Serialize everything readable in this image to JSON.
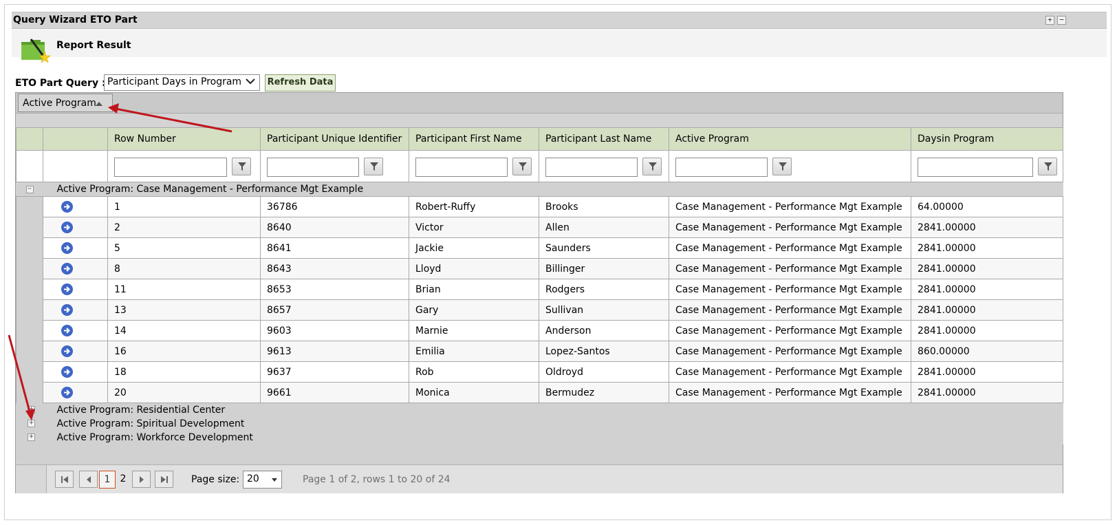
{
  "window": {
    "title": "Query Wizard ETO Part",
    "btn_maximize": "+",
    "btn_minimize": "−"
  },
  "report": {
    "label": "Report Result",
    "icon": "folder-wand-icon"
  },
  "query": {
    "label": "ETO Part Query :",
    "selected": "Participant Days in Program",
    "refresh_label": "Refresh Data"
  },
  "grouping": {
    "chip_label": "Active Program",
    "sort_direction": "ascending"
  },
  "columns": [
    "Row Number",
    "Participant Unique Identifier",
    "Participant First Name",
    "Participant Last Name",
    "Active Program",
    "Daysin Program"
  ],
  "groups": {
    "expanded": {
      "label": "Active Program: Case Management - Performance Mgt Example",
      "toggle": "−",
      "rows": [
        {
          "row": "1",
          "id": "36786",
          "first": "Robert-Ruffy",
          "last": "Brooks",
          "program": "Case Management - Performance Mgt Example",
          "days": "64.00000"
        },
        {
          "row": "2",
          "id": "8640",
          "first": "Victor",
          "last": "Allen",
          "program": "Case Management - Performance Mgt Example",
          "days": "2841.00000"
        },
        {
          "row": "5",
          "id": "8641",
          "first": "Jackie",
          "last": "Saunders",
          "program": "Case Management - Performance Mgt Example",
          "days": "2841.00000"
        },
        {
          "row": "8",
          "id": "8643",
          "first": "Lloyd",
          "last": "Billinger",
          "program": "Case Management - Performance Mgt Example",
          "days": "2841.00000"
        },
        {
          "row": "11",
          "id": "8653",
          "first": "Brian",
          "last": "Rodgers",
          "program": "Case Management - Performance Mgt Example",
          "days": "2841.00000"
        },
        {
          "row": "13",
          "id": "8657",
          "first": "Gary",
          "last": "Sullivan",
          "program": "Case Management - Performance Mgt Example",
          "days": "2841.00000"
        },
        {
          "row": "14",
          "id": "9603",
          "first": "Marnie",
          "last": "Anderson",
          "program": "Case Management - Performance Mgt Example",
          "days": "2841.00000"
        },
        {
          "row": "16",
          "id": "9613",
          "first": "Emilia",
          "last": "Lopez-Santos",
          "program": "Case Management - Performance Mgt Example",
          "days": "860.00000"
        },
        {
          "row": "18",
          "id": "9637",
          "first": "Rob",
          "last": "Oldroyd",
          "program": "Case Management - Performance Mgt Example",
          "days": "2841.00000"
        },
        {
          "row": "20",
          "id": "9661",
          "first": "Monica",
          "last": "Bermudez",
          "program": "Case Management - Performance Mgt Example",
          "days": "2841.00000"
        }
      ]
    },
    "collapsed": [
      {
        "label": "Active Program: Residential Center",
        "toggle": "+"
      },
      {
        "label": "Active Program: Spiritual Development",
        "toggle": "+"
      },
      {
        "label": "Active Program: Workforce Development",
        "toggle": "+"
      }
    ]
  },
  "pager": {
    "pages": [
      "1",
      "2"
    ],
    "current_page": "1",
    "page_size_label": "Page size:",
    "page_size": "20",
    "info": "Page 1 of 2, rows 1 to 20 of 24"
  },
  "colors": {
    "header_bg": "#d5e0c3",
    "grid_bg": "#d1d1d1",
    "row_icon": "#3f66c7",
    "annotation_arrow": "#c0161b",
    "current_page_border": "#d0501c"
  }
}
